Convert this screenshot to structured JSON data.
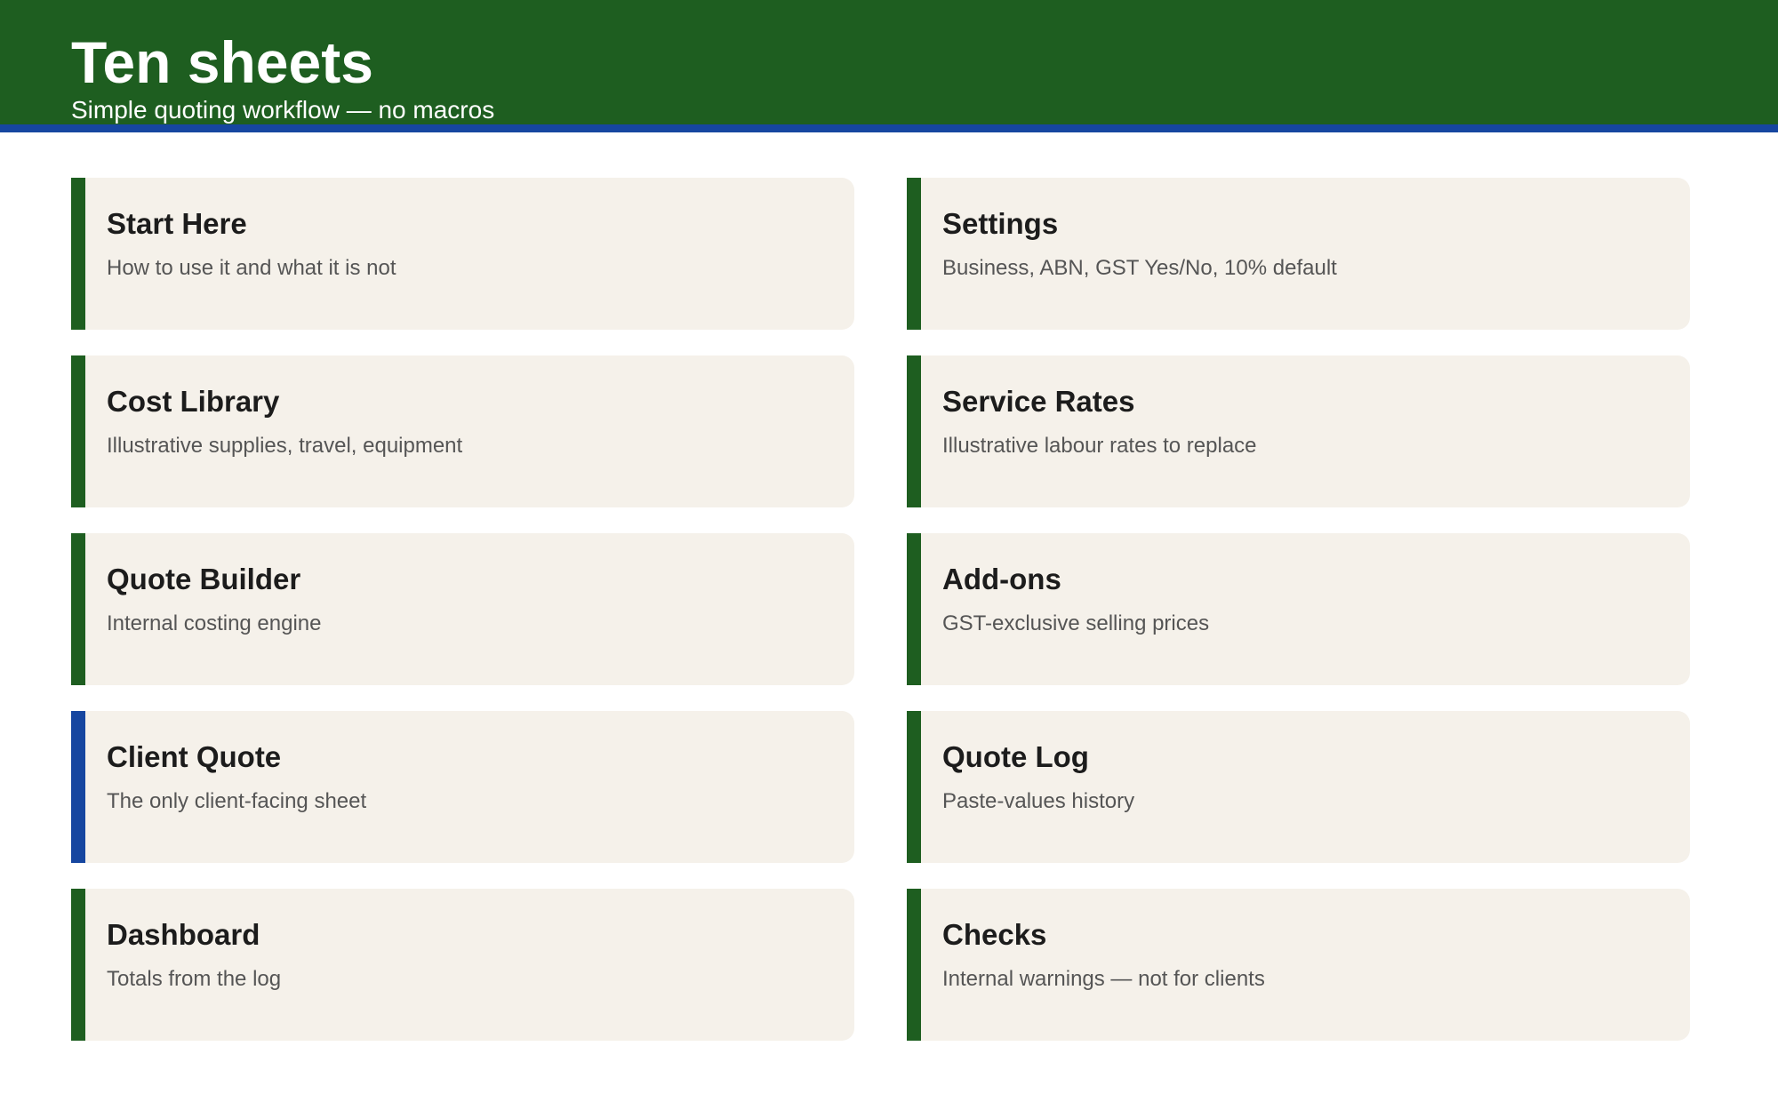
{
  "header": {
    "title": "Ten sheets",
    "subtitle": "Simple quoting workflow — no macros"
  },
  "colors": {
    "primary_green": "#1e5e20",
    "accent_blue": "#1646a0",
    "card_background": "#f5f1ea"
  },
  "sheets": [
    {
      "title": "Start Here",
      "description": "How to use it and what it is not",
      "accent": "green"
    },
    {
      "title": "Settings",
      "description": "Business, ABN, GST Yes/No, 10% default",
      "accent": "green"
    },
    {
      "title": "Cost Library",
      "description": "Illustrative supplies, travel, equipment",
      "accent": "green"
    },
    {
      "title": "Service Rates",
      "description": "Illustrative labour rates to replace",
      "accent": "green"
    },
    {
      "title": "Quote Builder",
      "description": "Internal costing engine",
      "accent": "green"
    },
    {
      "title": "Add-ons",
      "description": "GST-exclusive selling prices",
      "accent": "green"
    },
    {
      "title": "Client Quote",
      "description": "The only client-facing sheet",
      "accent": "blue"
    },
    {
      "title": "Quote Log",
      "description": "Paste-values history",
      "accent": "green"
    },
    {
      "title": "Dashboard",
      "description": "Totals from the log",
      "accent": "green"
    },
    {
      "title": "Checks",
      "description": "Internal warnings — not for clients",
      "accent": "green"
    }
  ]
}
